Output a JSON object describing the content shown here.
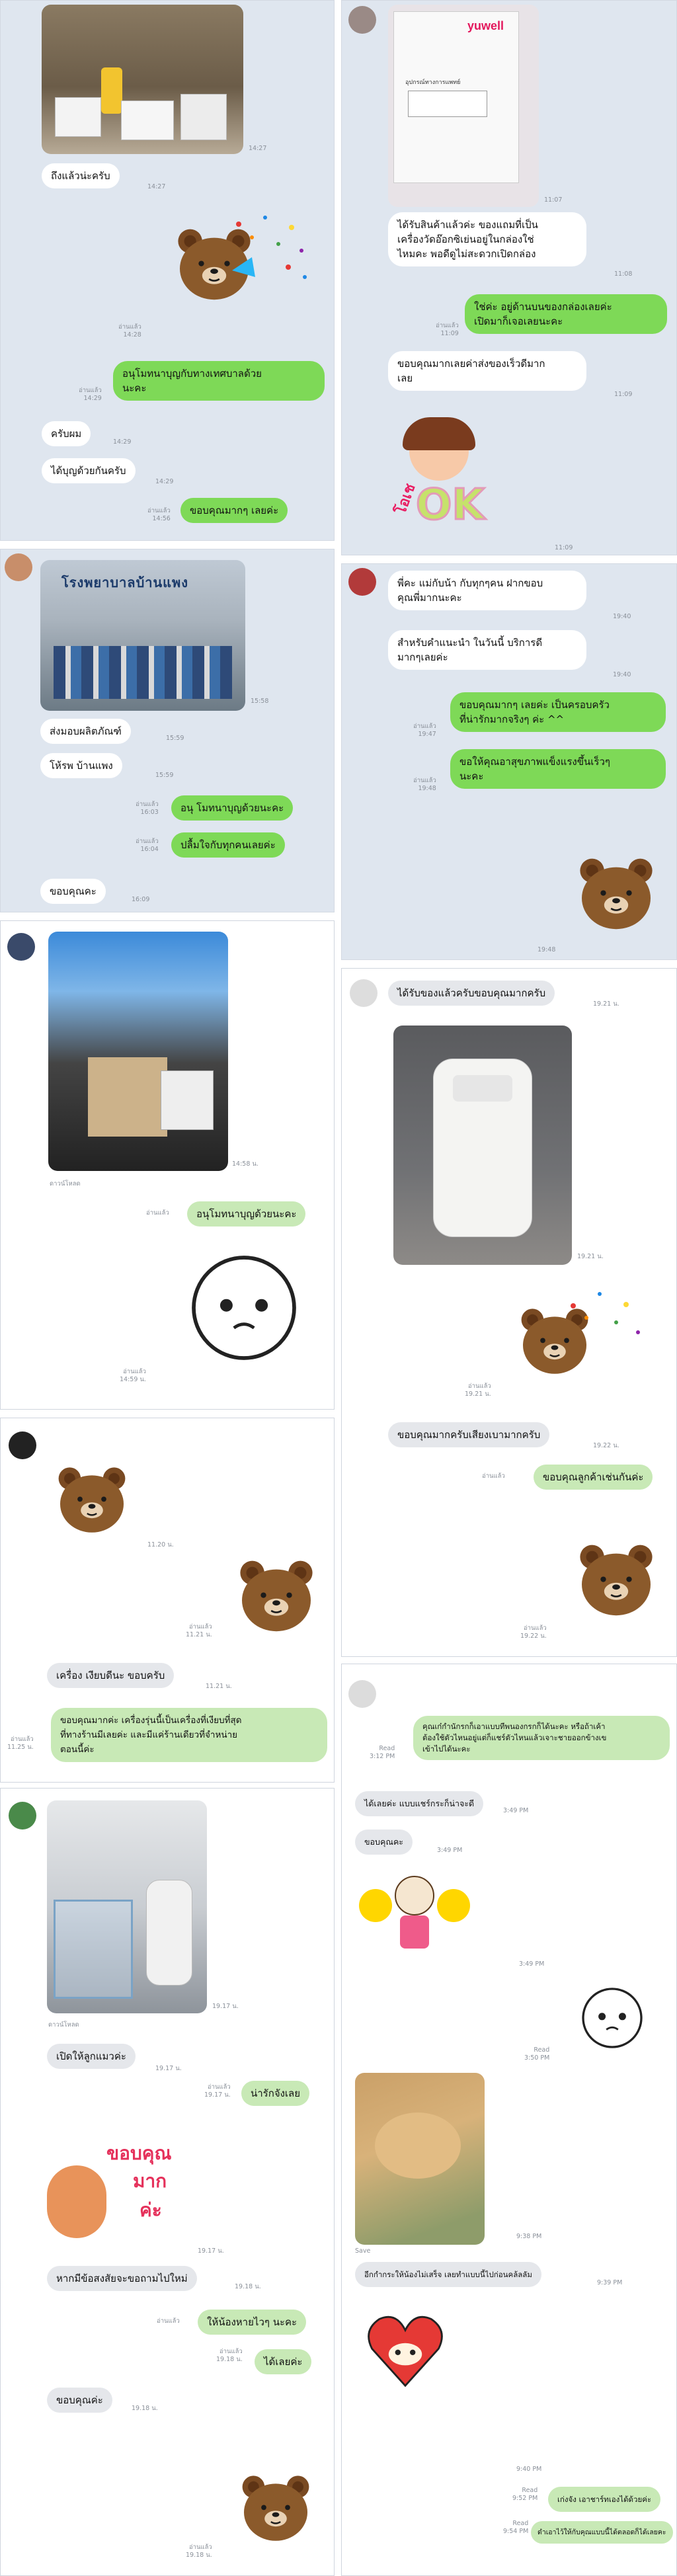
{
  "p1": {
    "t1": "14:27",
    "m1": "ถึงแล้วน่ะครับ",
    "t2": "14:27",
    "rt1": "อ่านแล้ว\n14:28",
    "rt2": "อ่านแล้ว\n14:29",
    "m2": "อนุโมทนาบุญกับทางเทศบาลด้วย\nนะคะ",
    "m3": "ครับผม",
    "t3": "14:29",
    "m4": "ได้บุญด้วยกันครับ",
    "t4": "14:29",
    "rt3": "อ่านแล้ว\n14:56",
    "m5": "ขอบคุณมากๆ เลยค่ะ"
  },
  "p2": {
    "box_brand": "yuwell",
    "box_line1": "อุปกรณ์ทางการแพทย์",
    "t1": "11:07",
    "m1": "ได้รับสินค้าแล้วค่ะ ของแถมที่เป็น\nเครื่องวัดอ๊อกซิเย่นอยู่ในกล่องใช่\nไหมคะ พอดีดูไม่สะดวกเปิดกล่อง",
    "t2": "11:08",
    "rt1": "อ่านแล้ว\n11:09",
    "m2": "ใช่ค่ะ อยู่ด้านบนของกล่องเลยค่ะ\nเปิดมาก็เจอเลยนะคะ",
    "m3": "ขอบคุณมากเลยค่าส่งของเร็วดีมาก\nเลย",
    "t3": "11:09",
    "t4": "11:09"
  },
  "p3": {
    "sign_text": "โรงพยาบาลบ้านแพง",
    "t1": "15:58",
    "m1": "ส่งมอบผลิตภัณฑ์",
    "t2": "15:59",
    "m2": "โห้รพ บ้านแพง",
    "t3": "15:59",
    "rt1": "อ่านแล้ว\n16:03",
    "m3": "อนุ โมทนาบุญด้วยนะคะ",
    "rt2": "อ่านแล้ว\n16:04",
    "m4": "ปลื้มใจกับทุกคนเลยค่ะ",
    "m5": "ขอบคุณคะ",
    "t4": "16:09"
  },
  "p4": {
    "m1": "พี่คะ แม่กับน้า กับทุกๆคน ฝากขอบ\nคุณพี่มากนะคะ",
    "t1": "19:40",
    "m2": "สำหรับคำแนะนำ ในวันนี้ บริการดี\nมากๆเลยค่ะ",
    "t2": "19:40",
    "rt1": "อ่านแล้ว\n19:47",
    "m3": "ขอบคุณมากๆ เลยค่ะ เป็นครอบครัว\nที่น่ารักมากจริงๆ ค่ะ ^^",
    "rt2": "อ่านแล้ว\n19:48",
    "m4": "ขอให้คุณอาสุขภาพแข็งแรงขึ้นเร็วๆ\nนะคะ",
    "t3": "19:48"
  },
  "p5": {
    "t1": "14:58 น.",
    "dl": "ดาวน์โหลด",
    "rd": "อ่านแล้ว",
    "m1": "อนุโมทนาบุญด้วยนะคะ",
    "rt1": "อ่านแล้ว\n14:59 น."
  },
  "p6": {
    "m1": "ได้รับของแล้วครับขอบคุณมากครับ",
    "t1": "19.21 น.",
    "t2": "19.21 น.",
    "rt1": "อ่านแล้ว\n19.21 น.",
    "m2": "ขอบคุณมากครับเสียงเบามากครับ",
    "t3": "19.22 น.",
    "rd": "อ่านแล้ว",
    "m3": "ขอบคุณลูกค้าเช่นกันค่ะ",
    "rt2": "อ่านแล้ว\n19.22 น."
  },
  "p7": {
    "t1": "11.20 น.",
    "rt1": "อ่านแล้ว\n11.21 น.",
    "m1": "เครื่อง เงียบดีนะ ขอบครับ",
    "t2": "11.21 น.",
    "rt2": "อ่านแล้ว\n11.25 น.",
    "m2": "ขอบคุณมากค่ะ เครื่องรุ่นนี้เป็นเครื่องที่เงียบที่สุด\nที่ทางร้านมีเลยค่ะ และมีแค่ร้านเดียวที่จำหน่าย\nตอนนี้ค่ะ"
  },
  "p8": {
    "rt1": "Read\n3:12 PM",
    "m1": "คุณเก๋กำนักรกก็เอาแบบทีพนองกรกก็ได้นะคะ หรือถ้าเค้า\nต้องใช้ตัวไหนอยู่แต่ก็แชร์ตัวไหนแล้วเจาะชายออกข้างเข\nเข้าไปได้นะคะ",
    "m2": "ได้เลยค่ะ แบบแชร์กระก็น่าจะดี",
    "t1": "3:49 PM",
    "m3": "ขอบคุณคะ",
    "t2": "3:49 PM",
    "t3": "3:49 PM",
    "rt2": "Read\n3:50 PM",
    "t4": "9:38 PM",
    "sv": "Save",
    "m4": "อีกกำกระให้น้องไม่เสร็จ เลยทำแบบนี้ไปก่อนคล้ลลัม",
    "t5": "9:39 PM",
    "t6": "9:40 PM",
    "rt3": "Read\n9:52 PM",
    "m5": "เก่งจัง เอาชาร์ทเองได้ด้วยค่ะ",
    "rt4": "Read\n9:54 PM",
    "m6": "ดำเอาไว้ให้กับคุณแบบนี้ได้ตลอดก็ได้เลยคะ"
  },
  "p9": {
    "dl": "ดาวน์โหลด",
    "t1": "19.17 น.",
    "m1": "เปิดให้ลูกแมวค่ะ",
    "t2": "19.17 น.",
    "rt1": "อ่านแล้ว\n19.17 น.",
    "m2": "น่ารักจังเลย",
    "st1": "ขอบคุณ",
    "st2": "มาก",
    "st3": "ค่ะ",
    "t3": "19.17 น.",
    "m3": "หากมีข้อสงสัยจะขอถามไปใหม่",
    "t4": "19.18 น.",
    "rt2": "อ่านแล้ว",
    "m4": "ให้น้องหายไวๆ นะคะ",
    "rt3": "อ่านแล้ว\n19.18 น.",
    "m5": "ได้เลยค่ะ",
    "m6": "ขอบคุณค่ะ",
    "t5": "19.18 น.",
    "rt4": "อ่านแล้ว\n19.18 น."
  },
  "stk": {
    "ok": "OK",
    "ok2": "โอเช"
  }
}
